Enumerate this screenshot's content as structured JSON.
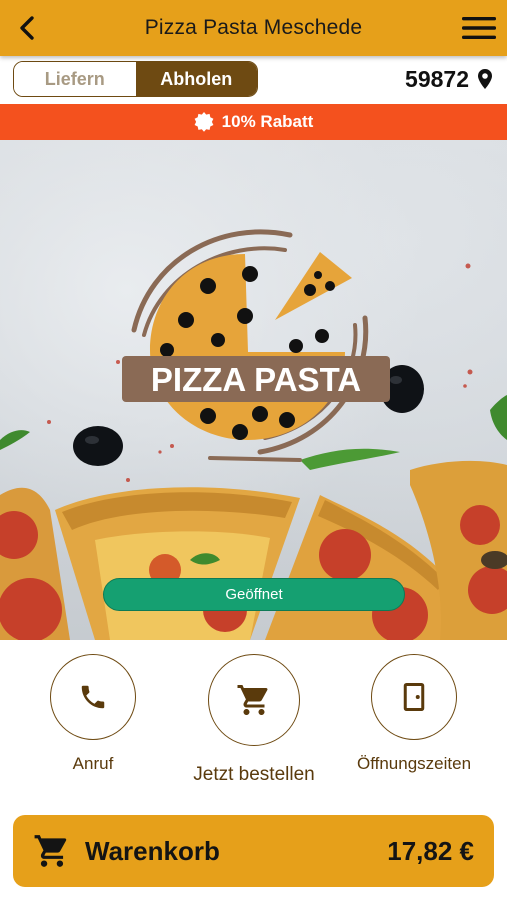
{
  "header": {
    "title": "Pizza Pasta Meschede",
    "back_icon": "chevron-left-icon",
    "menu_icon": "hamburger-menu-icon",
    "color": "#e6a01a"
  },
  "mode_toggle": {
    "options": [
      "Liefern",
      "Abholen"
    ],
    "selected": "Abholen"
  },
  "postal_code": {
    "value": "59872",
    "icon": "location-pin-icon"
  },
  "promo": {
    "text": "10% Rabatt",
    "icon": "discount-badge-icon",
    "color": "#f4511e"
  },
  "hero": {
    "logo_text": "PIZZA PASTA",
    "status_label": "Geöffnet",
    "status_color": "#15a071"
  },
  "actions": [
    {
      "label": "Anruf",
      "icon": "phone-icon"
    },
    {
      "label": "Jetzt bestellen",
      "icon": "shopping-cart-icon"
    },
    {
      "label": "Öffnungszeiten",
      "icon": "door-icon"
    }
  ],
  "cart": {
    "label": "Warenkorb",
    "total": "17,82 €",
    "icon": "shopping-cart-icon"
  }
}
